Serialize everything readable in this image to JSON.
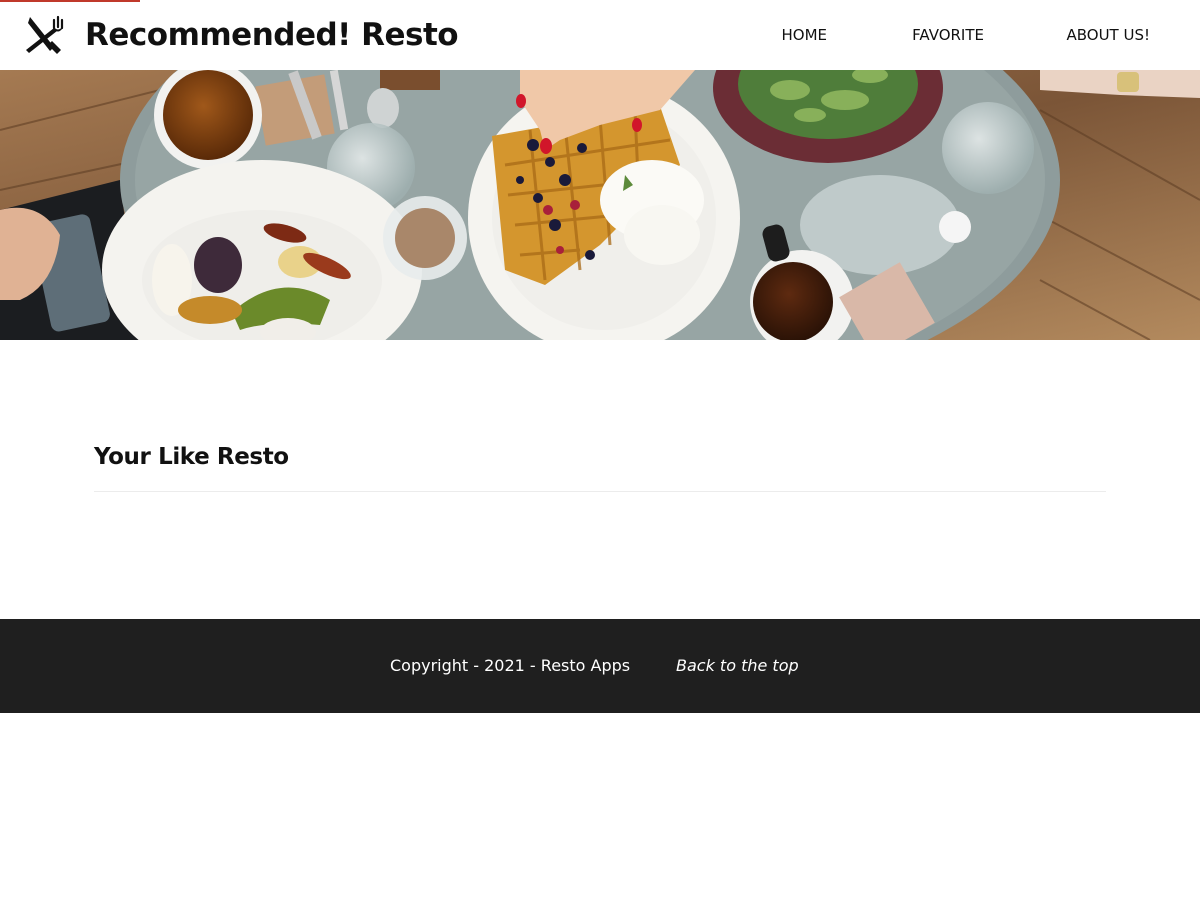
{
  "app": {
    "title": "Recommended! Resto",
    "logo_icon": "cutlery-icon"
  },
  "nav": {
    "items": [
      {
        "label": "HOME"
      },
      {
        "label": "FAVORITE"
      },
      {
        "label": "ABOUT US!"
      }
    ]
  },
  "hero": {
    "image": "overhead photo of a cafe table with waffles, salad, roasted vegetables and coffee"
  },
  "main": {
    "section_title": "Your Like Resto"
  },
  "footer": {
    "copyright": "Copyright - 2021 - Resto Apps",
    "back_to_top": "Back to the top"
  },
  "colors": {
    "footer_bg": "#1f1f1f",
    "accent": "#c0392b"
  }
}
